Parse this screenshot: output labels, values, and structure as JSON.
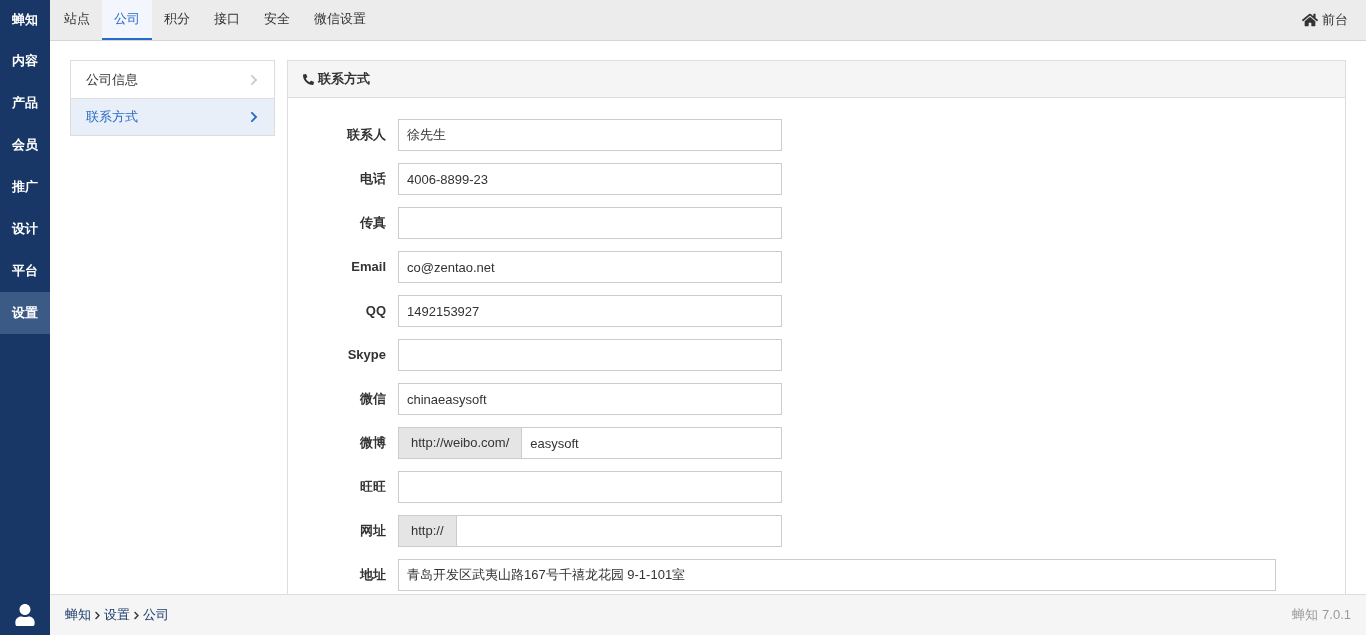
{
  "sidebar": {
    "logo": "蝉知",
    "items": [
      {
        "label": "内容",
        "selected": false
      },
      {
        "label": "产品",
        "selected": false
      },
      {
        "label": "会员",
        "selected": false
      },
      {
        "label": "推广",
        "selected": false
      },
      {
        "label": "设计",
        "selected": false
      },
      {
        "label": "平台",
        "selected": false
      },
      {
        "label": "设置",
        "selected": true
      }
    ]
  },
  "tabs": [
    {
      "label": "站点",
      "selected": false
    },
    {
      "label": "公司",
      "selected": true
    },
    {
      "label": "积分",
      "selected": false
    },
    {
      "label": "接口",
      "selected": false
    },
    {
      "label": "安全",
      "selected": false
    },
    {
      "label": "微信设置",
      "selected": false
    }
  ],
  "front_link": "前台",
  "side_menu": [
    {
      "label": "公司信息",
      "selected": false
    },
    {
      "label": "联系方式",
      "selected": true
    }
  ],
  "panel": {
    "title": "联系方式",
    "fields": [
      {
        "kind": "text",
        "label": "联系人",
        "value": "徐先生"
      },
      {
        "kind": "text",
        "label": "电话",
        "value": "4006-8899-23"
      },
      {
        "kind": "text",
        "label": "传真"
      },
      {
        "kind": "text",
        "label": "Email",
        "value": "co@zentao.net"
      },
      {
        "kind": "text",
        "label": "QQ",
        "value": "1492153927"
      },
      {
        "kind": "text",
        "label": "Skype"
      },
      {
        "kind": "text",
        "label": "微信",
        "value": "chinaeasysoft"
      },
      {
        "kind": "prefixed",
        "label": "微博",
        "prefix": "http://weibo.com/",
        "value": "easysoft"
      },
      {
        "kind": "text",
        "label": "旺旺"
      },
      {
        "kind": "prefixed",
        "label": "网址",
        "prefix": "http://"
      },
      {
        "kind": "wide",
        "label": "地址",
        "value": "青岛开发区武夷山路167号千禧龙花园 9-1-101室"
      }
    ]
  },
  "breadcrumb": [
    "蝉知",
    "设置",
    "公司"
  ],
  "version": {
    "brand": "蝉知",
    "number": "7.0.1"
  }
}
